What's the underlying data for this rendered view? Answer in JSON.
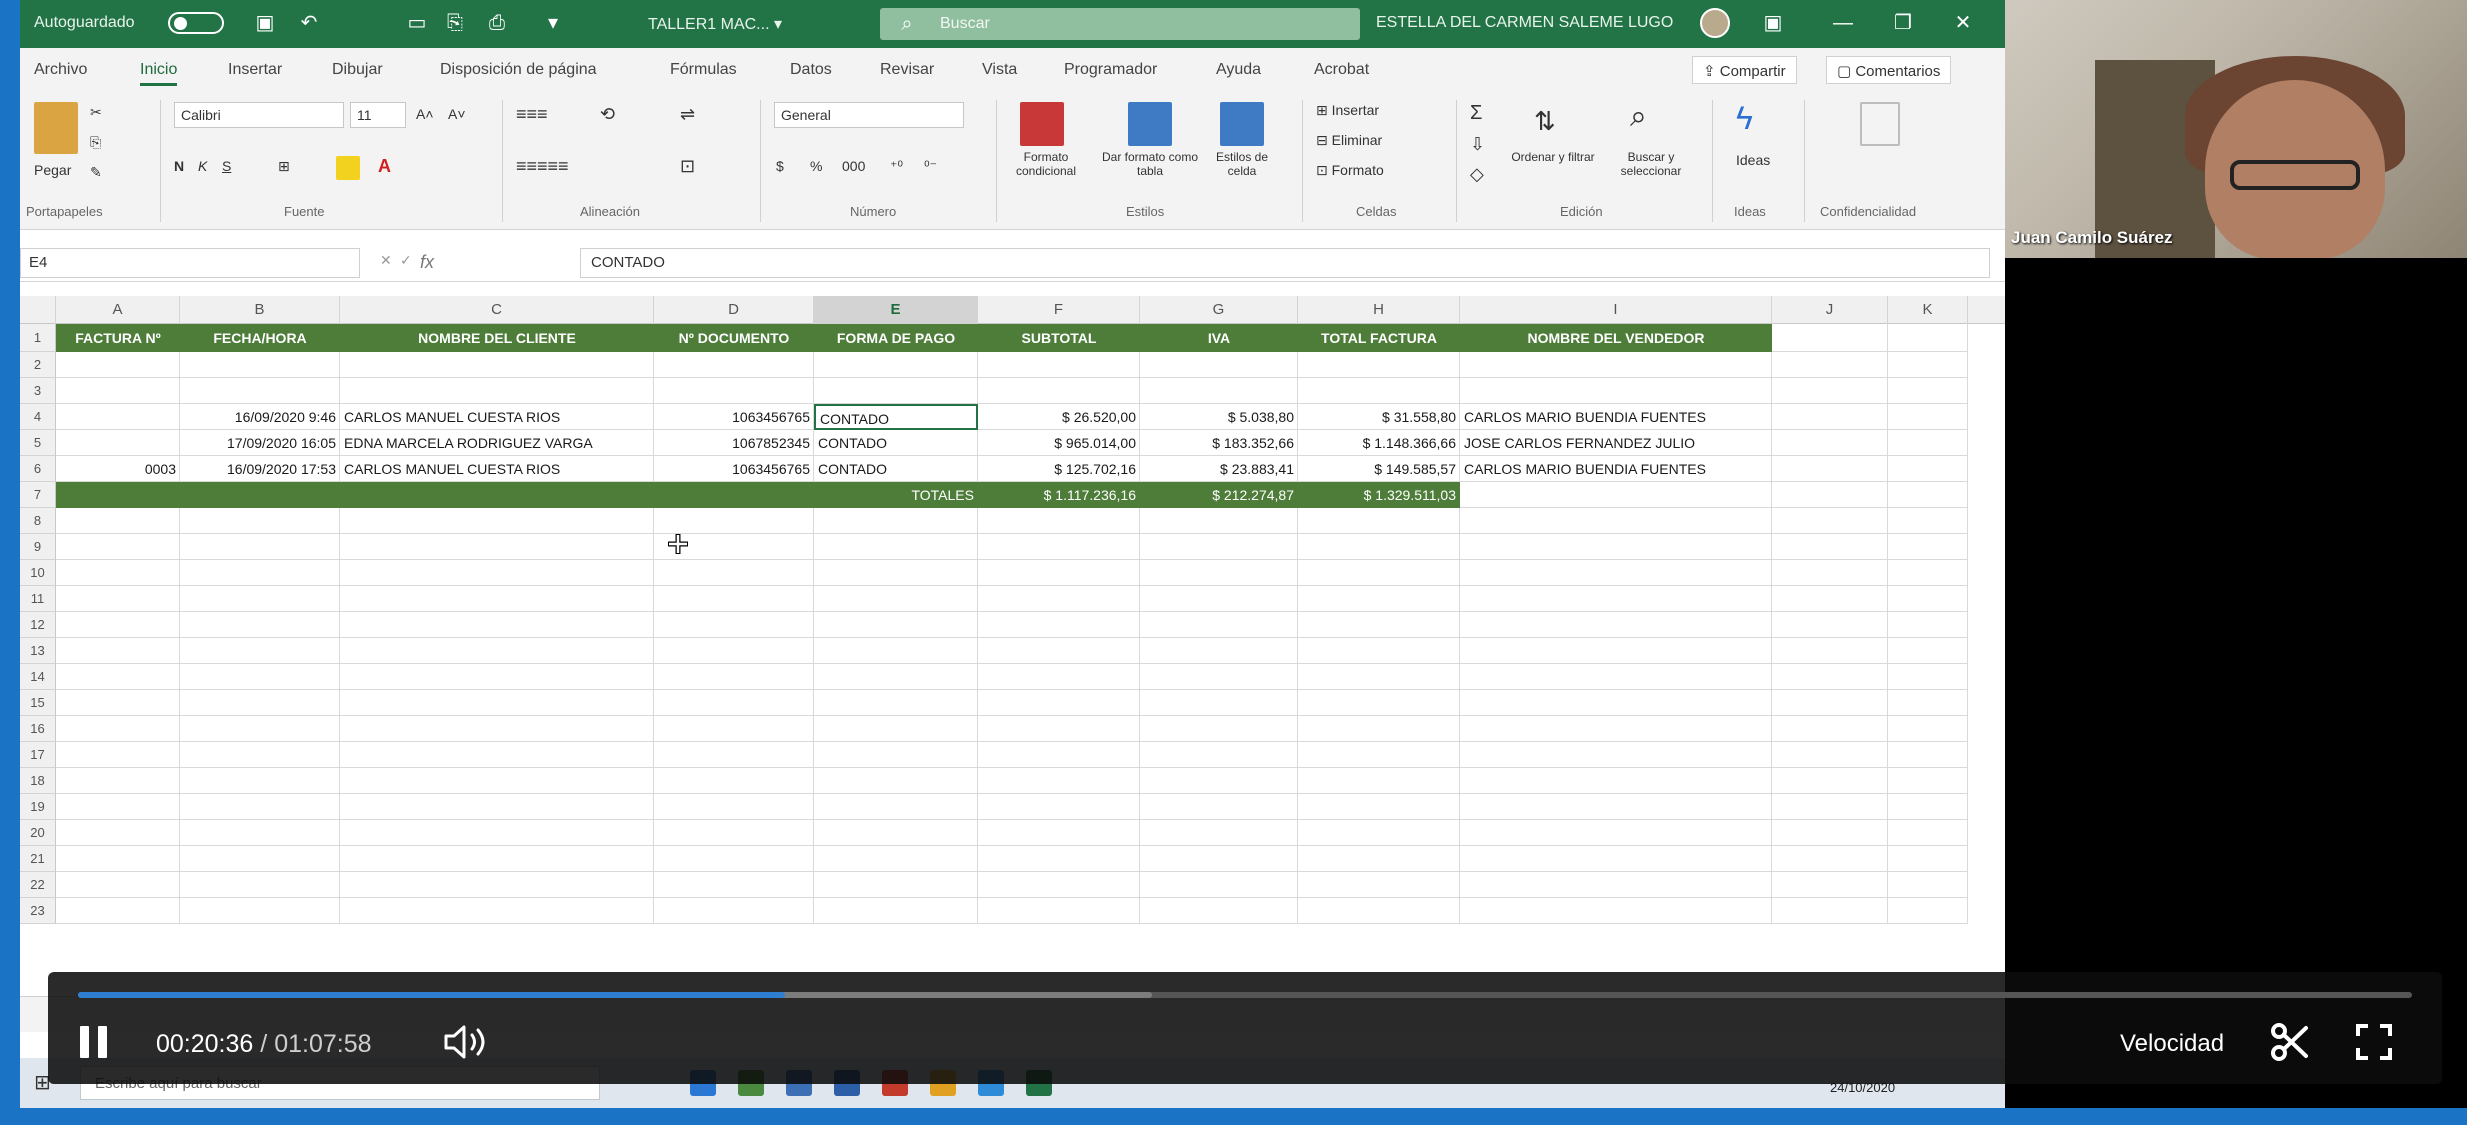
{
  "excel": {
    "autosave_label": "Autoguardado",
    "file_name": "TALLER1 MAC... ▾",
    "search_placeholder": "Buscar",
    "user_name": "ESTELLA DEL CARMEN SALEME LUGO",
    "tabs": [
      "Archivo",
      "Inicio",
      "Insertar",
      "Dibujar",
      "Disposición de página",
      "Fórmulas",
      "Datos",
      "Revisar",
      "Vista",
      "Programador",
      "Ayuda",
      "Acrobat"
    ],
    "active_tab": "Inicio",
    "share_label": "Compartir",
    "comments_label": "Comentarios",
    "ribbon": {
      "paste": "Pegar",
      "font_name": "Calibri",
      "font_size": "11",
      "number_format": "General",
      "cond_format": "Formato condicional",
      "format_table": "Dar formato como tabla",
      "cell_styles": "Estilos de celda",
      "insert": "Insertar",
      "delete": "Eliminar",
      "format": "Formato",
      "sort_filter": "Ordenar y filtrar",
      "find_select": "Buscar y seleccionar",
      "ideas": "Ideas",
      "groups": [
        "Portapapeles",
        "Fuente",
        "Alineación",
        "Número",
        "Estilos",
        "Celdas",
        "Edición",
        "Ideas",
        "Confidencialidad"
      ]
    },
    "name_box": "E4",
    "fx": "fx",
    "formula": "CONTADO",
    "columns": [
      "A",
      "B",
      "C",
      "D",
      "E",
      "F",
      "G",
      "H",
      "I",
      "J",
      "K"
    ],
    "selected_column": "E",
    "rows": [
      "1",
      "2",
      "3",
      "4",
      "5",
      "6",
      "7",
      "8",
      "9",
      "10",
      "11",
      "12",
      "13",
      "14",
      "15",
      "16",
      "17",
      "18",
      "19",
      "20",
      "21",
      "22",
      "23"
    ],
    "headers": [
      "FACTURA Nº",
      "FECHA/HORA",
      "NOMBRE DEL CLIENTE",
      "Nº DOCUMENTO",
      "FORMA DE PAGO",
      "SUBTOTAL",
      "IVA",
      "TOTAL FACTURA",
      "NOMBRE DEL VENDEDOR"
    ],
    "data_rows": [
      [
        "",
        "16/09/2020 9:46",
        "CARLOS MANUEL CUESTA RIOS",
        "1063456765",
        "CONTADO",
        "$ 26.520,00",
        "$ 5.038,80",
        "$ 31.558,80",
        "CARLOS MARIO BUENDIA FUENTES"
      ],
      [
        "",
        "17/09/2020 16:05",
        "EDNA MARCELA RODRIGUEZ VARGA",
        "1067852345",
        "CONTADO",
        "$ 965.014,00",
        "$ 183.352,66",
        "$ 1.148.366,66",
        "JOSE CARLOS FERNANDEZ JULIO"
      ],
      [
        "0003",
        "16/09/2020 17:53",
        "CARLOS MANUEL CUESTA RIOS",
        "1063456765",
        "CONTADO",
        "$ 125.702,16",
        "$ 23.883,41",
        "$ 149.585,57",
        "CARLOS MARIO BUENDIA FUENTES"
      ]
    ],
    "totals_label": "TOTALES",
    "totals": [
      "$ 1.117.236,16",
      "$ 212.274,87",
      "$ 1.329.511,03"
    ]
  },
  "taskbar": {
    "search_placeholder": "Escribe aquí para buscar",
    "date": "24/10/2020"
  },
  "participant": {
    "name": "Juan Camilo Suárez"
  },
  "player": {
    "current_time": "00:20:36",
    "separator": "/",
    "duration": "01:07:58",
    "progress": 0.303,
    "buffered": 0.46,
    "speed_label": "Velocidad"
  },
  "colors": {
    "excel_green": "#227447",
    "header_green": "#4e7d3a",
    "frame_blue": "#1a73c4",
    "progress_blue": "#2e7fd1"
  }
}
